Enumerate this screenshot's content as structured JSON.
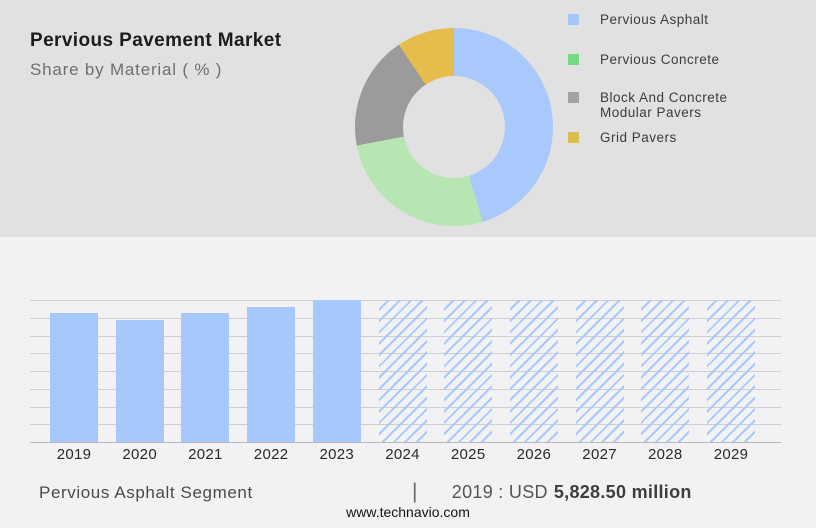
{
  "header": {
    "title": "Pervious Pavement Market",
    "subtitle": "Share by Material ( % )"
  },
  "footer": {
    "segment_label": "Pervious Asphalt Segment",
    "divider": "|",
    "value_prefix": "2019 : USD",
    "value": "5,828.50 million",
    "website": "www.technavio.com"
  },
  "colors": {
    "top_panel_bg": "#e1e1e1",
    "page_bg": "#f2f2f4",
    "bar_fill": "#a7c8fc",
    "hatch_line": "#a9c9fb",
    "gridline": "#cfcfcf"
  },
  "chart_data": [
    {
      "type": "pie",
      "subtype": "donut",
      "title": "Share by Material ( % )",
      "legend_position": "right",
      "start_angle_deg": 0,
      "direction": "clockwise",
      "segments": [
        {
          "label": "Pervious Asphalt",
          "pct": 45.3,
          "color": "#a9c8fb",
          "legend_color": "#a3c7f9"
        },
        {
          "label": "Pervious Concrete",
          "pct": 26.7,
          "color": "#b7e6b2",
          "legend_color": "#72db81"
        },
        {
          "label": "Block And Concrete Modular Pavers",
          "pct": 18.6,
          "color": "#9b9b9b",
          "legend_color": "#a3a3a3"
        },
        {
          "label": "Grid Pavers",
          "pct": 9.4,
          "color": "#e6bc4d",
          "legend_color": "#dabf4e"
        }
      ]
    },
    {
      "type": "bar",
      "title": "Pervious Asphalt Segment",
      "unit": "USD million",
      "grid": true,
      "categories": [
        "2019",
        "2020",
        "2021",
        "2022",
        "2023",
        "2024",
        "2025",
        "2026",
        "2027",
        "2028",
        "2029"
      ],
      "series": [
        {
          "name": "Pervious Asphalt Segment",
          "values_musd": [
            5828.5,
            5530,
            5830,
            6125,
            6445,
            null,
            null,
            null,
            null,
            null,
            null
          ],
          "bar_height_fraction": [
            0.905,
            0.859,
            0.905,
            0.951,
            1.0,
            1.0,
            1.0,
            1.0,
            1.0,
            1.0,
            1.0
          ]
        }
      ],
      "forecast_years": [
        "2024",
        "2025",
        "2026",
        "2027",
        "2028",
        "2029"
      ],
      "labeled_point": {
        "year": "2019",
        "value": "USD 5,828.50 million"
      }
    }
  ]
}
